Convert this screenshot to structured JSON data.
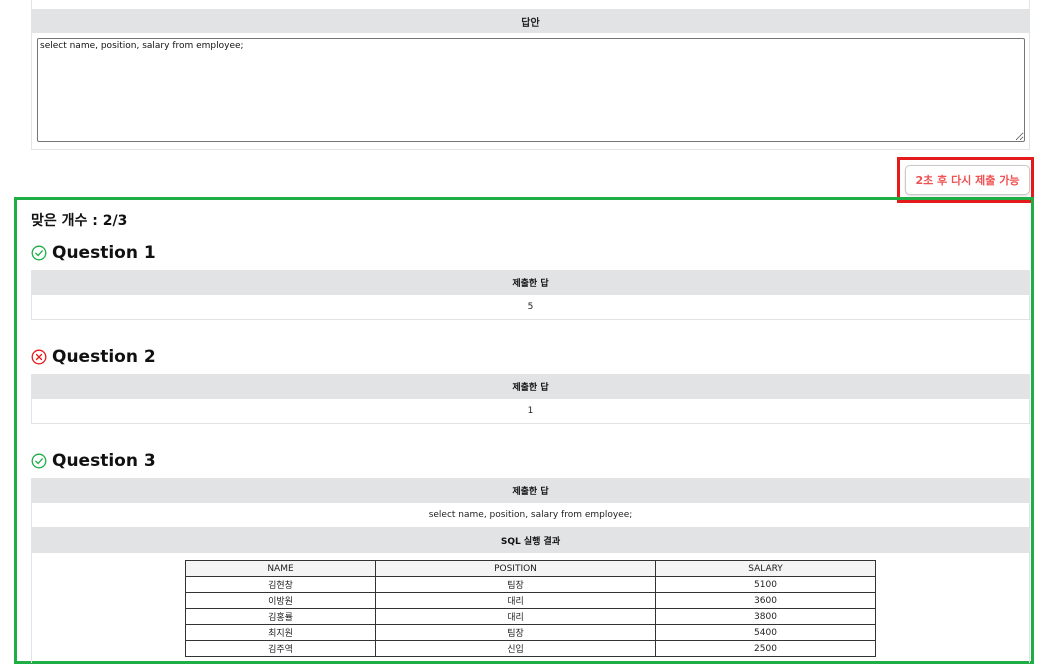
{
  "answer": {
    "header": "답안",
    "text": "select name, position, salary from employee;"
  },
  "resubmit_button": {
    "label": "2초 후 다시 제출 가능"
  },
  "score": {
    "label": "맞은 개수 : 2/3"
  },
  "questions": [
    {
      "title": "Question 1",
      "status": "correct",
      "submitted_header": "제출한 답",
      "submitted_value": "5"
    },
    {
      "title": "Question 2",
      "status": "incorrect",
      "submitted_header": "제출한 답",
      "submitted_value": "1"
    },
    {
      "title": "Question 3",
      "status": "correct",
      "submitted_header": "제출한 답",
      "submitted_value": "select name, position, salary from employee;",
      "result_header": "SQL 실행 결과",
      "result_table": {
        "columns": [
          "NAME",
          "POSITION",
          "SALARY"
        ],
        "rows": [
          [
            "김현창",
            "팀장",
            "5100"
          ],
          [
            "이방원",
            "대리",
            "3600"
          ],
          [
            "김홍률",
            "대리",
            "3800"
          ],
          [
            "최지원",
            "팀장",
            "5400"
          ],
          [
            "김주역",
            "신입",
            "2500"
          ]
        ]
      }
    }
  ],
  "colors": {
    "correct": "#1fae46",
    "incorrect": "#e41b1b",
    "button_text": "#f05252"
  }
}
